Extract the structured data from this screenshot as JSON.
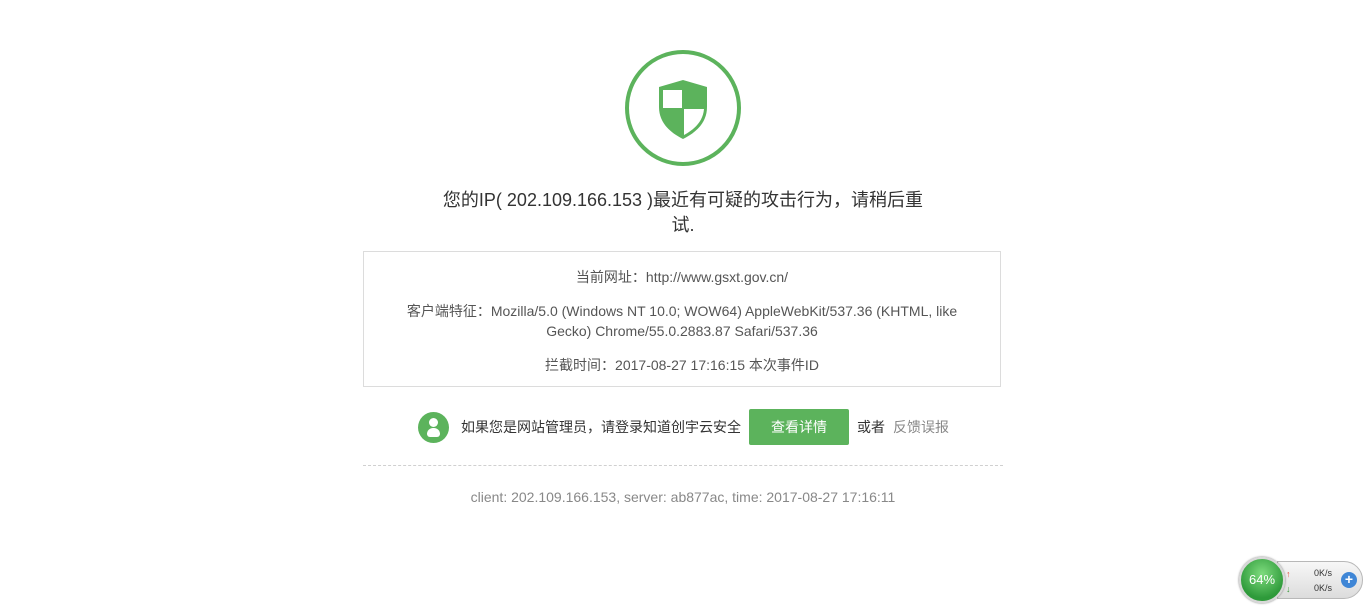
{
  "icons": {
    "shield": "shield-icon",
    "admin": "user-icon",
    "upload": "arrow-up-icon",
    "download": "arrow-down-icon",
    "add": "plus-icon"
  },
  "colors": {
    "accent": "#5cb35c",
    "text": "#333333",
    "muted": "#888888"
  },
  "headline": {
    "line1": "您的IP( 202.109.166.153 )最近有可疑的攻击行为，请稍后重",
    "line2": "试."
  },
  "info": {
    "url": "当前网址：http://www.gsxt.gov.cn/",
    "user_agent": "客户端特征：Mozilla/5.0 (Windows NT 10.0; WOW64) AppleWebKit/537.36 (KHTML, like Gecko) Chrome/55.0.2883.87 Safari/537.36",
    "intercept_time": "拦截时间：2017-08-27 17:16:15  本次事件ID"
  },
  "admin": {
    "prompt": "如果您是网站管理员，请登录知道创宇云安全",
    "detail_button": "查看详情",
    "or_text": "或者",
    "report_link": "反馈误报"
  },
  "footer": {
    "client_info": "client: 202.109.166.153, server: ab877ac, time: 2017-08-27 17:16:11"
  },
  "speed_widget": {
    "percent": "64%",
    "upload": "0K/s",
    "download": "0K/s"
  }
}
